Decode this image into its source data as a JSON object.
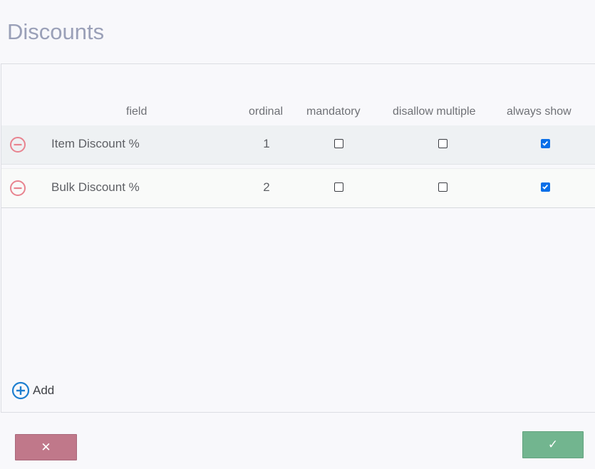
{
  "page": {
    "title": "Discounts"
  },
  "table": {
    "columns": {
      "field": "field",
      "ordinal": "ordinal",
      "mandatory": "mandatory",
      "disallow_multiple": "disallow multiple",
      "always_show": "always show"
    },
    "rows": [
      {
        "field": "Item Discount %",
        "ordinal": "1",
        "mandatory": false,
        "disallow_multiple": false,
        "always_show": true
      },
      {
        "field": "Bulk Discount %",
        "ordinal": "2",
        "mandatory": false,
        "disallow_multiple": false,
        "always_show": true
      }
    ]
  },
  "actions": {
    "add_label": "Add",
    "cancel_glyph": "✕",
    "confirm_glyph": "✓"
  },
  "icons": {
    "remove": "minus-circle-icon",
    "add": "plus-circle-icon",
    "check": "checkmark-icon"
  },
  "colors": {
    "title": "#9aa0b8",
    "remove_icon": "#e8838f",
    "add_icon": "#1e7fd0",
    "checkbox_checked": "#0a6fe8",
    "cancel_button": "#c0788a",
    "confirm_button": "#72b58f"
  }
}
